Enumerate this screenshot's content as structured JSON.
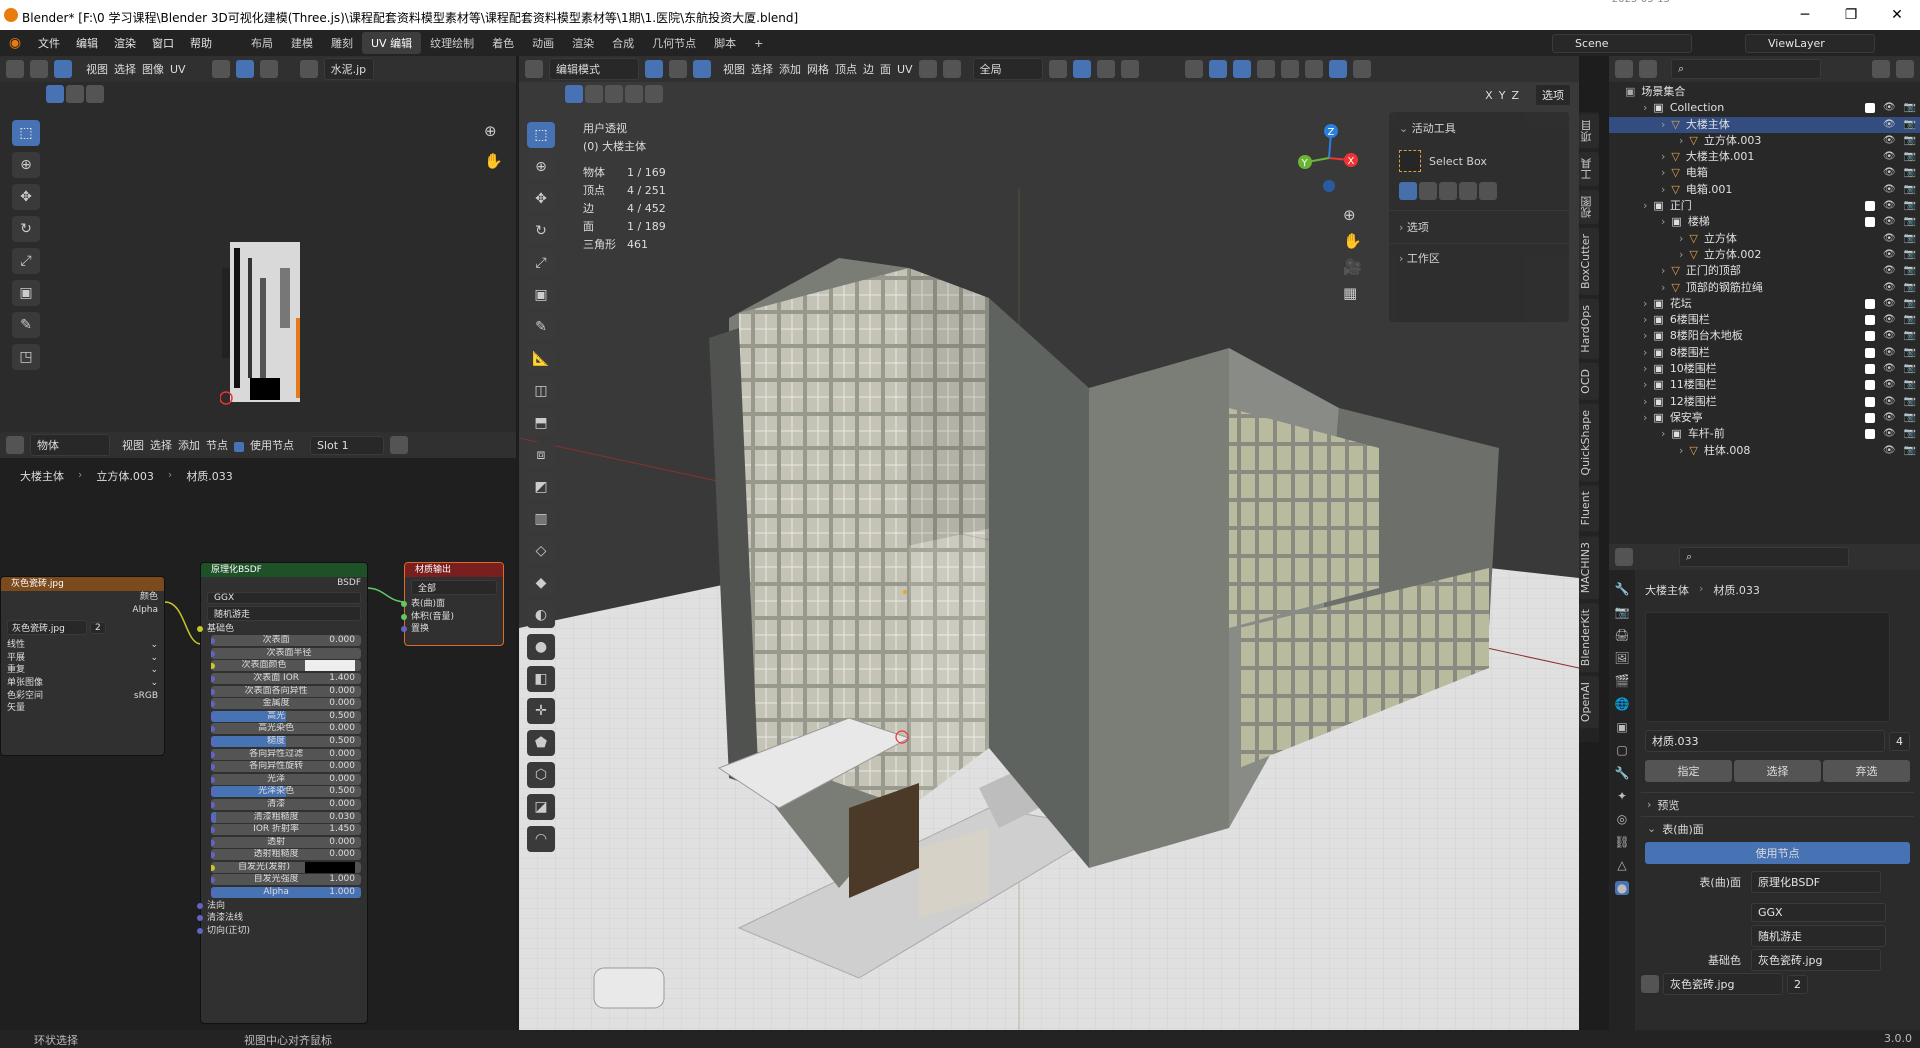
{
  "window": {
    "title": "Blender* [F:\\0 学习课程\\Blender 3D可视化建模(Three.js)\\课程配套资料模型素材等\\课程配套资料模型素材等\\1期\\1.医院\\东航投资大厦.blend]",
    "clock": "2025-05-15",
    "buttons": [
      "─",
      "❐",
      "✕"
    ]
  },
  "topbar": {
    "menus": [
      "文件",
      "编辑",
      "渲染",
      "窗口",
      "帮助"
    ],
    "workspaces": [
      "布局",
      "建模",
      "雕刻",
      "UV 编辑",
      "纹理绘制",
      "着色",
      "动画",
      "渲染",
      "合成",
      "几何节点",
      "脚本"
    ],
    "active_workspace": "UV 编辑",
    "scene": "Scene",
    "view_layer": "ViewLayer"
  },
  "uv_editor": {
    "menus": [
      "视图",
      "选择",
      "图像",
      "UV"
    ],
    "image_name": "水泥.jp"
  },
  "node_editor": {
    "object_type": "物体",
    "menus": [
      "视图",
      "选择",
      "添加",
      "节点"
    ],
    "use_nodes": "使用节点",
    "slot": "Slot 1",
    "breadcrumb": [
      "大楼主体",
      "立方体.003",
      "材质.033"
    ],
    "image_node": {
      "title": "灰色瓷砖.jpg",
      "outputs": [
        "颜色",
        "Alpha"
      ],
      "image": "灰色瓷砖.jpg",
      "users": "2",
      "options": [
        "线性",
        "平展",
        "重复",
        "单张图像"
      ],
      "color_space_label": "色彩空间",
      "color_space": "sRGB",
      "vector": "矢量"
    },
    "bsdf_node": {
      "title": "原理化BSDF",
      "output": "BSDF",
      "distribution": "GGX",
      "subsurface_method": "随机游走",
      "base_color": "基础色",
      "fields": [
        {
          "label": "次表面",
          "value": "0.000",
          "fill": 0
        },
        {
          "label": "次表面半径",
          "value": "",
          "fill": 0
        },
        {
          "label": "次表面颜色",
          "value": "",
          "fill": 0
        },
        {
          "label": "次表面 IOR",
          "value": "1.400",
          "fill": 0
        },
        {
          "label": "次表面各向异性",
          "value": "0.000",
          "fill": 0
        },
        {
          "label": "金属度",
          "value": "0.000",
          "fill": 0
        },
        {
          "label": "高光",
          "value": "0.500",
          "fill": 0.5
        },
        {
          "label": "高光染色",
          "value": "0.000",
          "fill": 0
        },
        {
          "label": "糙度",
          "value": "0.500",
          "fill": 0.5
        },
        {
          "label": "各向异性过滤",
          "value": "0.000",
          "fill": 0
        },
        {
          "label": "各向异性旋转",
          "value": "0.000",
          "fill": 0
        },
        {
          "label": "光泽",
          "value": "0.000",
          "fill": 0
        },
        {
          "label": "光泽染色",
          "value": "0.500",
          "fill": 0.5
        },
        {
          "label": "清漆",
          "value": "0.000",
          "fill": 0
        },
        {
          "label": "清漆粗糙度",
          "value": "0.030",
          "fill": 0.03
        },
        {
          "label": "IOR 折射率",
          "value": "1.450",
          "fill": 0
        },
        {
          "label": "透射",
          "value": "0.000",
          "fill": 0
        },
        {
          "label": "透射粗糙度",
          "value": "0.000",
          "fill": 0
        },
        {
          "label": "自发光(发射)",
          "value": "",
          "fill": 0
        },
        {
          "label": "自发光强度",
          "value": "1.000",
          "fill": 0
        },
        {
          "label": "Alpha",
          "value": "1.000",
          "fill": 1
        }
      ],
      "inputs_tail": [
        "法向",
        "清漆法线",
        "切向(正切)"
      ]
    },
    "output_node": {
      "title": "材质输出",
      "target": "全部",
      "inputs": [
        "表(曲)面",
        "体积(音量)",
        "置换"
      ]
    }
  },
  "viewport": {
    "mode": "编辑模式",
    "menus": [
      "视图",
      "选择",
      "添加",
      "网格",
      "顶点",
      "边",
      "面",
      "UV"
    ],
    "orientation": "全局",
    "options": "选项",
    "axes": [
      "X",
      "Y",
      "Z"
    ],
    "view_name": "用户透视",
    "object_name": "(0) 大楼主体",
    "stats": [
      {
        "k": "物体",
        "v": "1 / 169"
      },
      {
        "k": "顶点",
        "v": "4 / 251"
      },
      {
        "k": "边",
        "v": "4 / 452"
      },
      {
        "k": "面",
        "v": "1 / 189"
      },
      {
        "k": "三角形",
        "v": "461"
      }
    ],
    "tool_panel": {
      "title": "活动工具",
      "tool": "Select Box",
      "sections": [
        "选项",
        "工作区"
      ]
    },
    "side_tabs": [
      "项目",
      "工具",
      "视图",
      "BoxCutter",
      "HardOps",
      "OCD",
      "QuickShape",
      "Fluent",
      "MACHIN3",
      "BlenderKit",
      "OpenAI"
    ],
    "gizmo": {
      "x": "X",
      "y": "Y",
      "z": "Z"
    }
  },
  "outliner": {
    "root": "场景集合",
    "rows": [
      {
        "name": "Collection",
        "indent": 1,
        "type": "coll",
        "sel": false
      },
      {
        "name": "大楼主体",
        "indent": 2,
        "type": "mesh",
        "sel": true
      },
      {
        "name": "立方体.003",
        "indent": 3,
        "type": "mesh",
        "sel": false
      },
      {
        "name": "大楼主体.001",
        "indent": 2,
        "type": "mesh",
        "sel": false
      },
      {
        "name": "电箱",
        "indent": 2,
        "type": "mesh",
        "sel": false
      },
      {
        "name": "电箱.001",
        "indent": 2,
        "type": "mesh",
        "sel": false
      },
      {
        "name": "正门",
        "indent": 1,
        "type": "coll",
        "sel": false
      },
      {
        "name": "楼梯",
        "indent": 2,
        "type": "coll",
        "sel": false
      },
      {
        "name": "立方体",
        "indent": 3,
        "type": "mesh",
        "sel": false
      },
      {
        "name": "立方体.002",
        "indent": 3,
        "type": "mesh",
        "sel": false
      },
      {
        "name": "正门的顶部",
        "indent": 2,
        "type": "mesh",
        "sel": false
      },
      {
        "name": "顶部的钢筋拉绳",
        "indent": 2,
        "type": "mesh",
        "sel": false
      },
      {
        "name": "花坛",
        "indent": 1,
        "type": "coll",
        "sel": false
      },
      {
        "name": "6楼围栏",
        "indent": 1,
        "type": "coll",
        "sel": false
      },
      {
        "name": "8楼阳台木地板",
        "indent": 1,
        "type": "coll",
        "sel": false
      },
      {
        "name": "8楼围栏",
        "indent": 1,
        "type": "coll",
        "sel": false
      },
      {
        "name": "10楼围栏",
        "indent": 1,
        "type": "coll",
        "sel": false
      },
      {
        "name": "11楼围栏",
        "indent": 1,
        "type": "coll",
        "sel": false
      },
      {
        "name": "12楼围栏",
        "indent": 1,
        "type": "coll",
        "sel": false
      },
      {
        "name": "保安亭",
        "indent": 1,
        "type": "coll",
        "sel": false
      },
      {
        "name": "车杆-前",
        "indent": 2,
        "type": "coll",
        "sel": false
      },
      {
        "name": "柱体.008",
        "indent": 3,
        "type": "mesh",
        "sel": false
      }
    ]
  },
  "properties": {
    "breadcrumb": [
      "大楼主体",
      "材质.033"
    ],
    "material": "材质.033",
    "users": "4",
    "buttons": [
      "指定",
      "选择",
      "弃选"
    ],
    "sections": [
      "预览",
      "表(曲)面"
    ],
    "use_nodes": "使用节点",
    "surface_label": "表(曲)面",
    "surface_value": "原理化BSDF",
    "distribution": "GGX",
    "subsurface": "随机游走",
    "base_color_label": "基础色",
    "base_color_value": "灰色瓷砖.jpg",
    "image": "灰色瓷砖.jpg",
    "image_users": "2"
  },
  "status": {
    "left": "环状选择",
    "middle": "视图中心对齐鼠标",
    "version": "3.0.0"
  }
}
